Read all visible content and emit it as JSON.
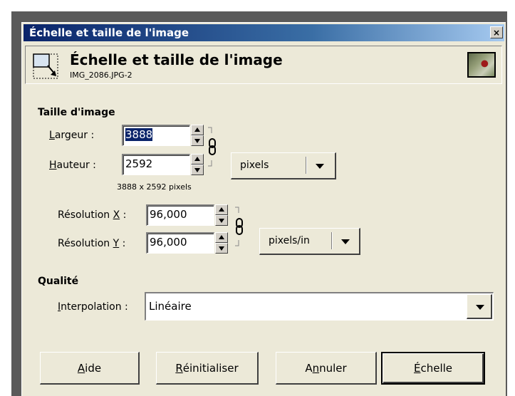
{
  "window": {
    "title": "Échelle et taille de l'image",
    "close_label": "×"
  },
  "header": {
    "title": "Échelle et taille de l'image",
    "subtitle": "IMG_2086.JPG-2"
  },
  "image_size": {
    "section_label": "Taille d'image",
    "width_label_prefix": "",
    "width_label_key": "L",
    "width_label_rest": "argeur :",
    "width_value": "3888",
    "height_label_key": "H",
    "height_label_rest": "auteur :",
    "height_value": "2592",
    "size_summary": "3888 x 2592 pixels",
    "unit": "pixels",
    "res_x_label_pre": "Résolution ",
    "res_x_label_key": "X",
    "res_x_label_post": " :",
    "res_x_value": "96,000",
    "res_y_label_pre": "Résolution ",
    "res_y_label_key": "Y",
    "res_y_label_post": " :",
    "res_y_value": "96,000",
    "res_unit": "pixels/in"
  },
  "quality": {
    "section_label": "Qualité",
    "interp_label_key": "I",
    "interp_label_rest": "nterpolation :",
    "interp_value": "Linéaire"
  },
  "buttons": {
    "help_key": "A",
    "help_rest": "ide",
    "reset_key": "R",
    "reset_rest": "éinitialiser",
    "cancel_pre": "A",
    "cancel_key": "n",
    "cancel_rest": "nuler",
    "scale_key": "É",
    "scale_rest": "chelle"
  }
}
